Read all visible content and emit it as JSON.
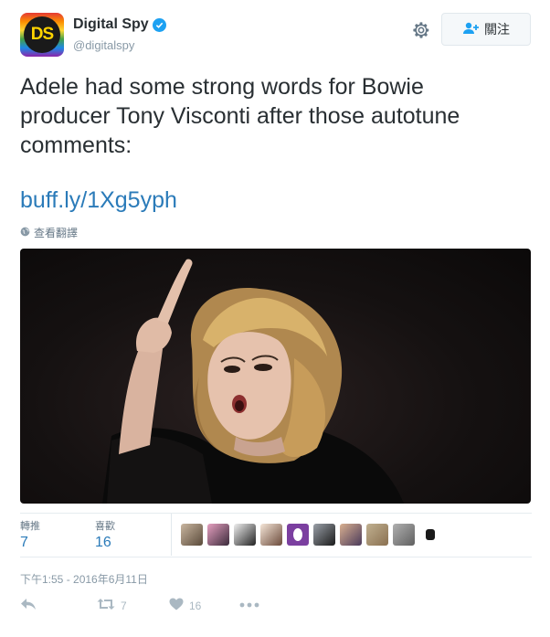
{
  "header": {
    "avatar_text": "DS",
    "display_name": "Digital Spy",
    "handle": "@digitalspy",
    "follow_label": "關注"
  },
  "tweet": {
    "text": "Adele had some strong words for Bowie producer Tony Visconti after those autotune comments:",
    "link": "buff.ly/1Xg5yph",
    "translate_label": "查看翻譯"
  },
  "stats": {
    "retweets_label": "轉推",
    "retweets_value": "7",
    "likes_label": "喜歡",
    "likes_value": "16"
  },
  "timestamp": "下午1:55 - 2016年6月11日",
  "actions": {
    "retweet_count": "7",
    "like_count": "16"
  },
  "icons": [
    "gear-icon",
    "verified-icon",
    "add-user-icon",
    "globe-icon",
    "reply-icon",
    "retweet-icon",
    "heart-icon",
    "more-icon"
  ],
  "colors": {
    "link": "#2b7bb9",
    "verified": "#1da1f2",
    "muted": "#8899a6"
  }
}
